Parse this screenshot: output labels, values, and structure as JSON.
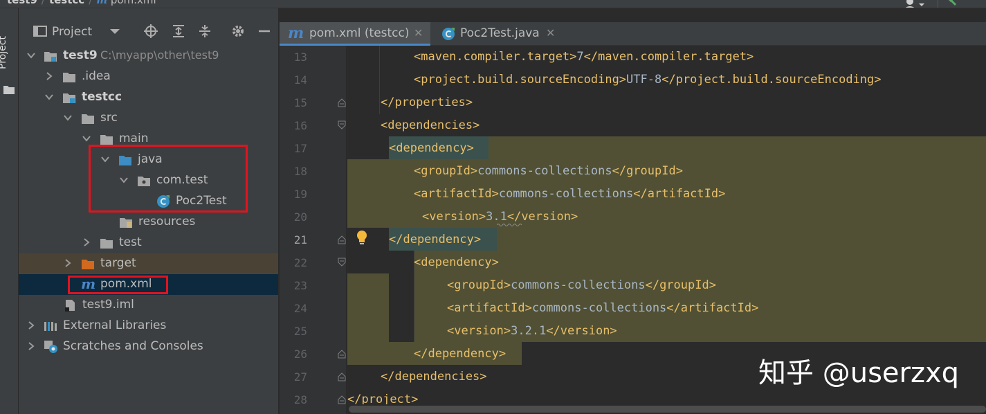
{
  "breadcrumb": {
    "root": "test9",
    "module": "testcc",
    "file": "pom.xml"
  },
  "left_strip": {
    "project_tab": "Project"
  },
  "project_panel": {
    "title": "Project",
    "tree": [
      {
        "label": "test9",
        "path": "C:\\myapp\\other\\test9"
      },
      {
        "label": ".idea"
      },
      {
        "label": "testcc"
      },
      {
        "label": "src"
      },
      {
        "label": "main"
      },
      {
        "label": "java"
      },
      {
        "label": "com.test"
      },
      {
        "label": "Poc2Test"
      },
      {
        "label": "resources"
      },
      {
        "label": "test"
      },
      {
        "label": "target"
      },
      {
        "label": "pom.xml"
      },
      {
        "label": "test9.iml"
      },
      {
        "label": "External Libraries"
      },
      {
        "label": "Scratches and Consoles"
      }
    ]
  },
  "editor": {
    "tabs": [
      {
        "label": "pom.xml (testcc)",
        "active": true
      },
      {
        "label": "Poc2Test.java",
        "active": false
      }
    ],
    "current_line": 21,
    "lines": [
      {
        "num": "13",
        "code": "<maven.compiler.target>7</maven.compiler.target>"
      },
      {
        "num": "14",
        "code": "<project.build.sourceEncoding>UTF-8</project.build.sourceEncoding>"
      },
      {
        "num": "15",
        "code": "</properties>"
      },
      {
        "num": "16",
        "code": "<dependencies>"
      },
      {
        "num": "17",
        "code": "<dependency>"
      },
      {
        "num": "18",
        "code": "<groupId>commons-collections</groupId>"
      },
      {
        "num": "19",
        "code": "<artifactId>commons-collections</artifactId>"
      },
      {
        "num": "20",
        "code": "<version>3.1</version>"
      },
      {
        "num": "21",
        "code": "</dependency>"
      },
      {
        "num": "22",
        "code": "<dependency>"
      },
      {
        "num": "23",
        "code": "<groupId>commons-collections</groupId>"
      },
      {
        "num": "24",
        "code": "<artifactId>commons-collections</artifactId>"
      },
      {
        "num": "25",
        "code": "<version>3.2.1</version>"
      },
      {
        "num": "26",
        "code": "</dependency>"
      },
      {
        "num": "27",
        "code": "</dependencies>"
      },
      {
        "num": "28",
        "code": "</project>"
      }
    ]
  },
  "watermark": "知乎 @userzxq",
  "colors": {
    "panel_bg": "#3c3f41",
    "editor_bg": "#2b2b2b",
    "tag": "#e8bf6a",
    "text": "#a9b7c6",
    "selection": "#0d293e",
    "annotation_red": "#e0141e"
  }
}
